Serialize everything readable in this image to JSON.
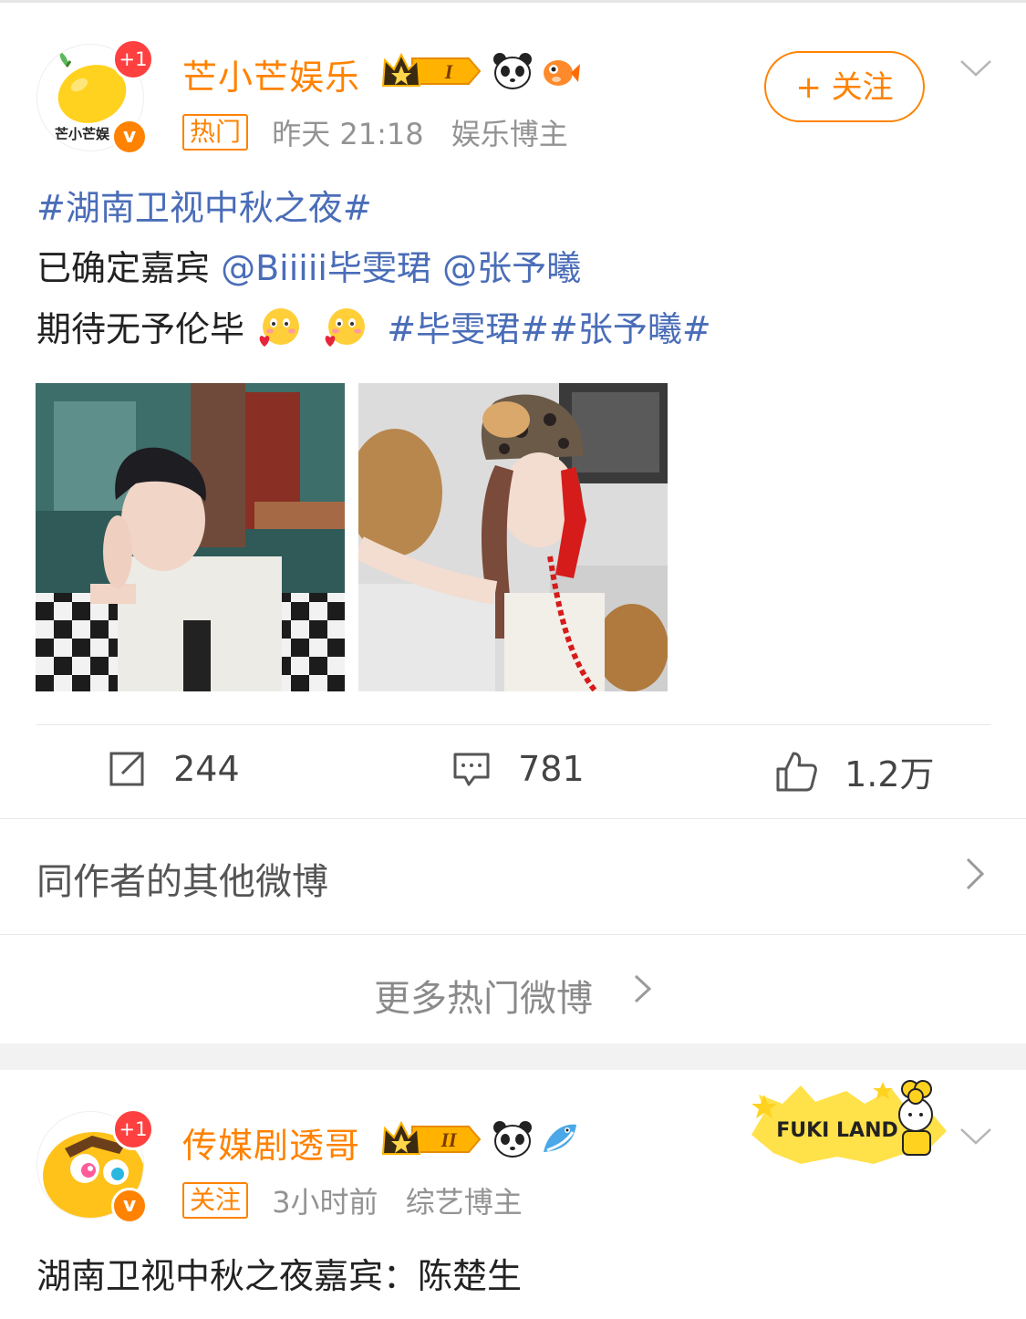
{
  "post1": {
    "badge_plus": "+1",
    "avatar_text": "芒小芒娱",
    "author": "芒小芒娱乐",
    "level_badge": "I",
    "meta_tag": "热门",
    "time": "昨天 21:18",
    "role": "娱乐博主",
    "follow_label": "+ 关注",
    "topic": "#湖南卫视中秋之夜#",
    "line2_prefix": "已确定嘉宾",
    "mention1": "@Biiiii毕雯珺",
    "mention2": "@张予曦",
    "line3_prefix": "期待无予伦毕",
    "tags": "#毕雯珺##张予曦#",
    "repost_count": "244",
    "comment_count": "781",
    "like_count": "1.2万",
    "other_posts_label": "同作者的其他微博",
    "more_hot_label": "更多热门微博"
  },
  "post2": {
    "badge_plus": "+1",
    "author": "传媒剧透哥",
    "level_badge": "II",
    "meta_tag": "关注",
    "time": "3小时前",
    "role": "综艺博主",
    "sticker_text": "FUKI LAND",
    "content": "湖南卫视中秋之夜嘉宾：陈楚生"
  },
  "colors": {
    "accent": "#ff8200",
    "link": "#4a6db8",
    "badge_red": "#ff4040"
  }
}
